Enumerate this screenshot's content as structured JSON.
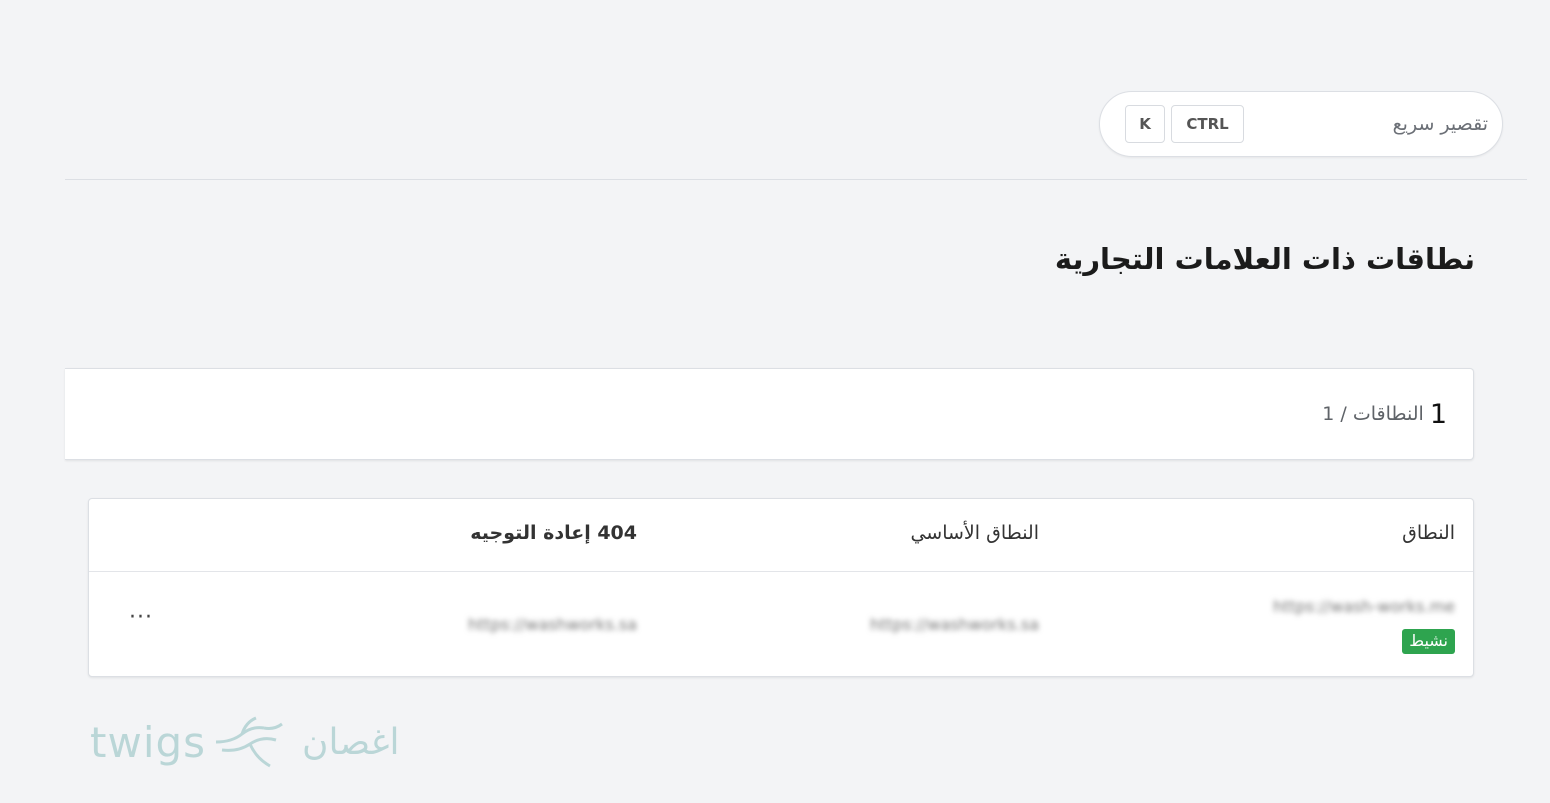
{
  "header": {
    "quick_search_label": "تقصير سريع",
    "shortcut_ctrl": "CTRL",
    "shortcut_k": "K"
  },
  "page": {
    "title": "نطاقات ذات العلامات التجارية"
  },
  "summary": {
    "count": "1",
    "text": "النطاقات / 1"
  },
  "table": {
    "columns": {
      "domain": "النطاق",
      "primary": "النطاق الأساسي",
      "redirect": "404 إعادة التوجيه"
    },
    "rows": [
      {
        "domain": "https://wash-works.me",
        "status": "نشيط",
        "primary": "https://washworks.sa",
        "redirect": "https://washworks.sa",
        "actions": "···"
      }
    ]
  },
  "watermark": {
    "latin": "twigs",
    "arabic": "اغصان"
  },
  "colors": {
    "background": "#f3f4f6",
    "status_active": "#2ea44f",
    "watermark": "#2a8a8a"
  }
}
